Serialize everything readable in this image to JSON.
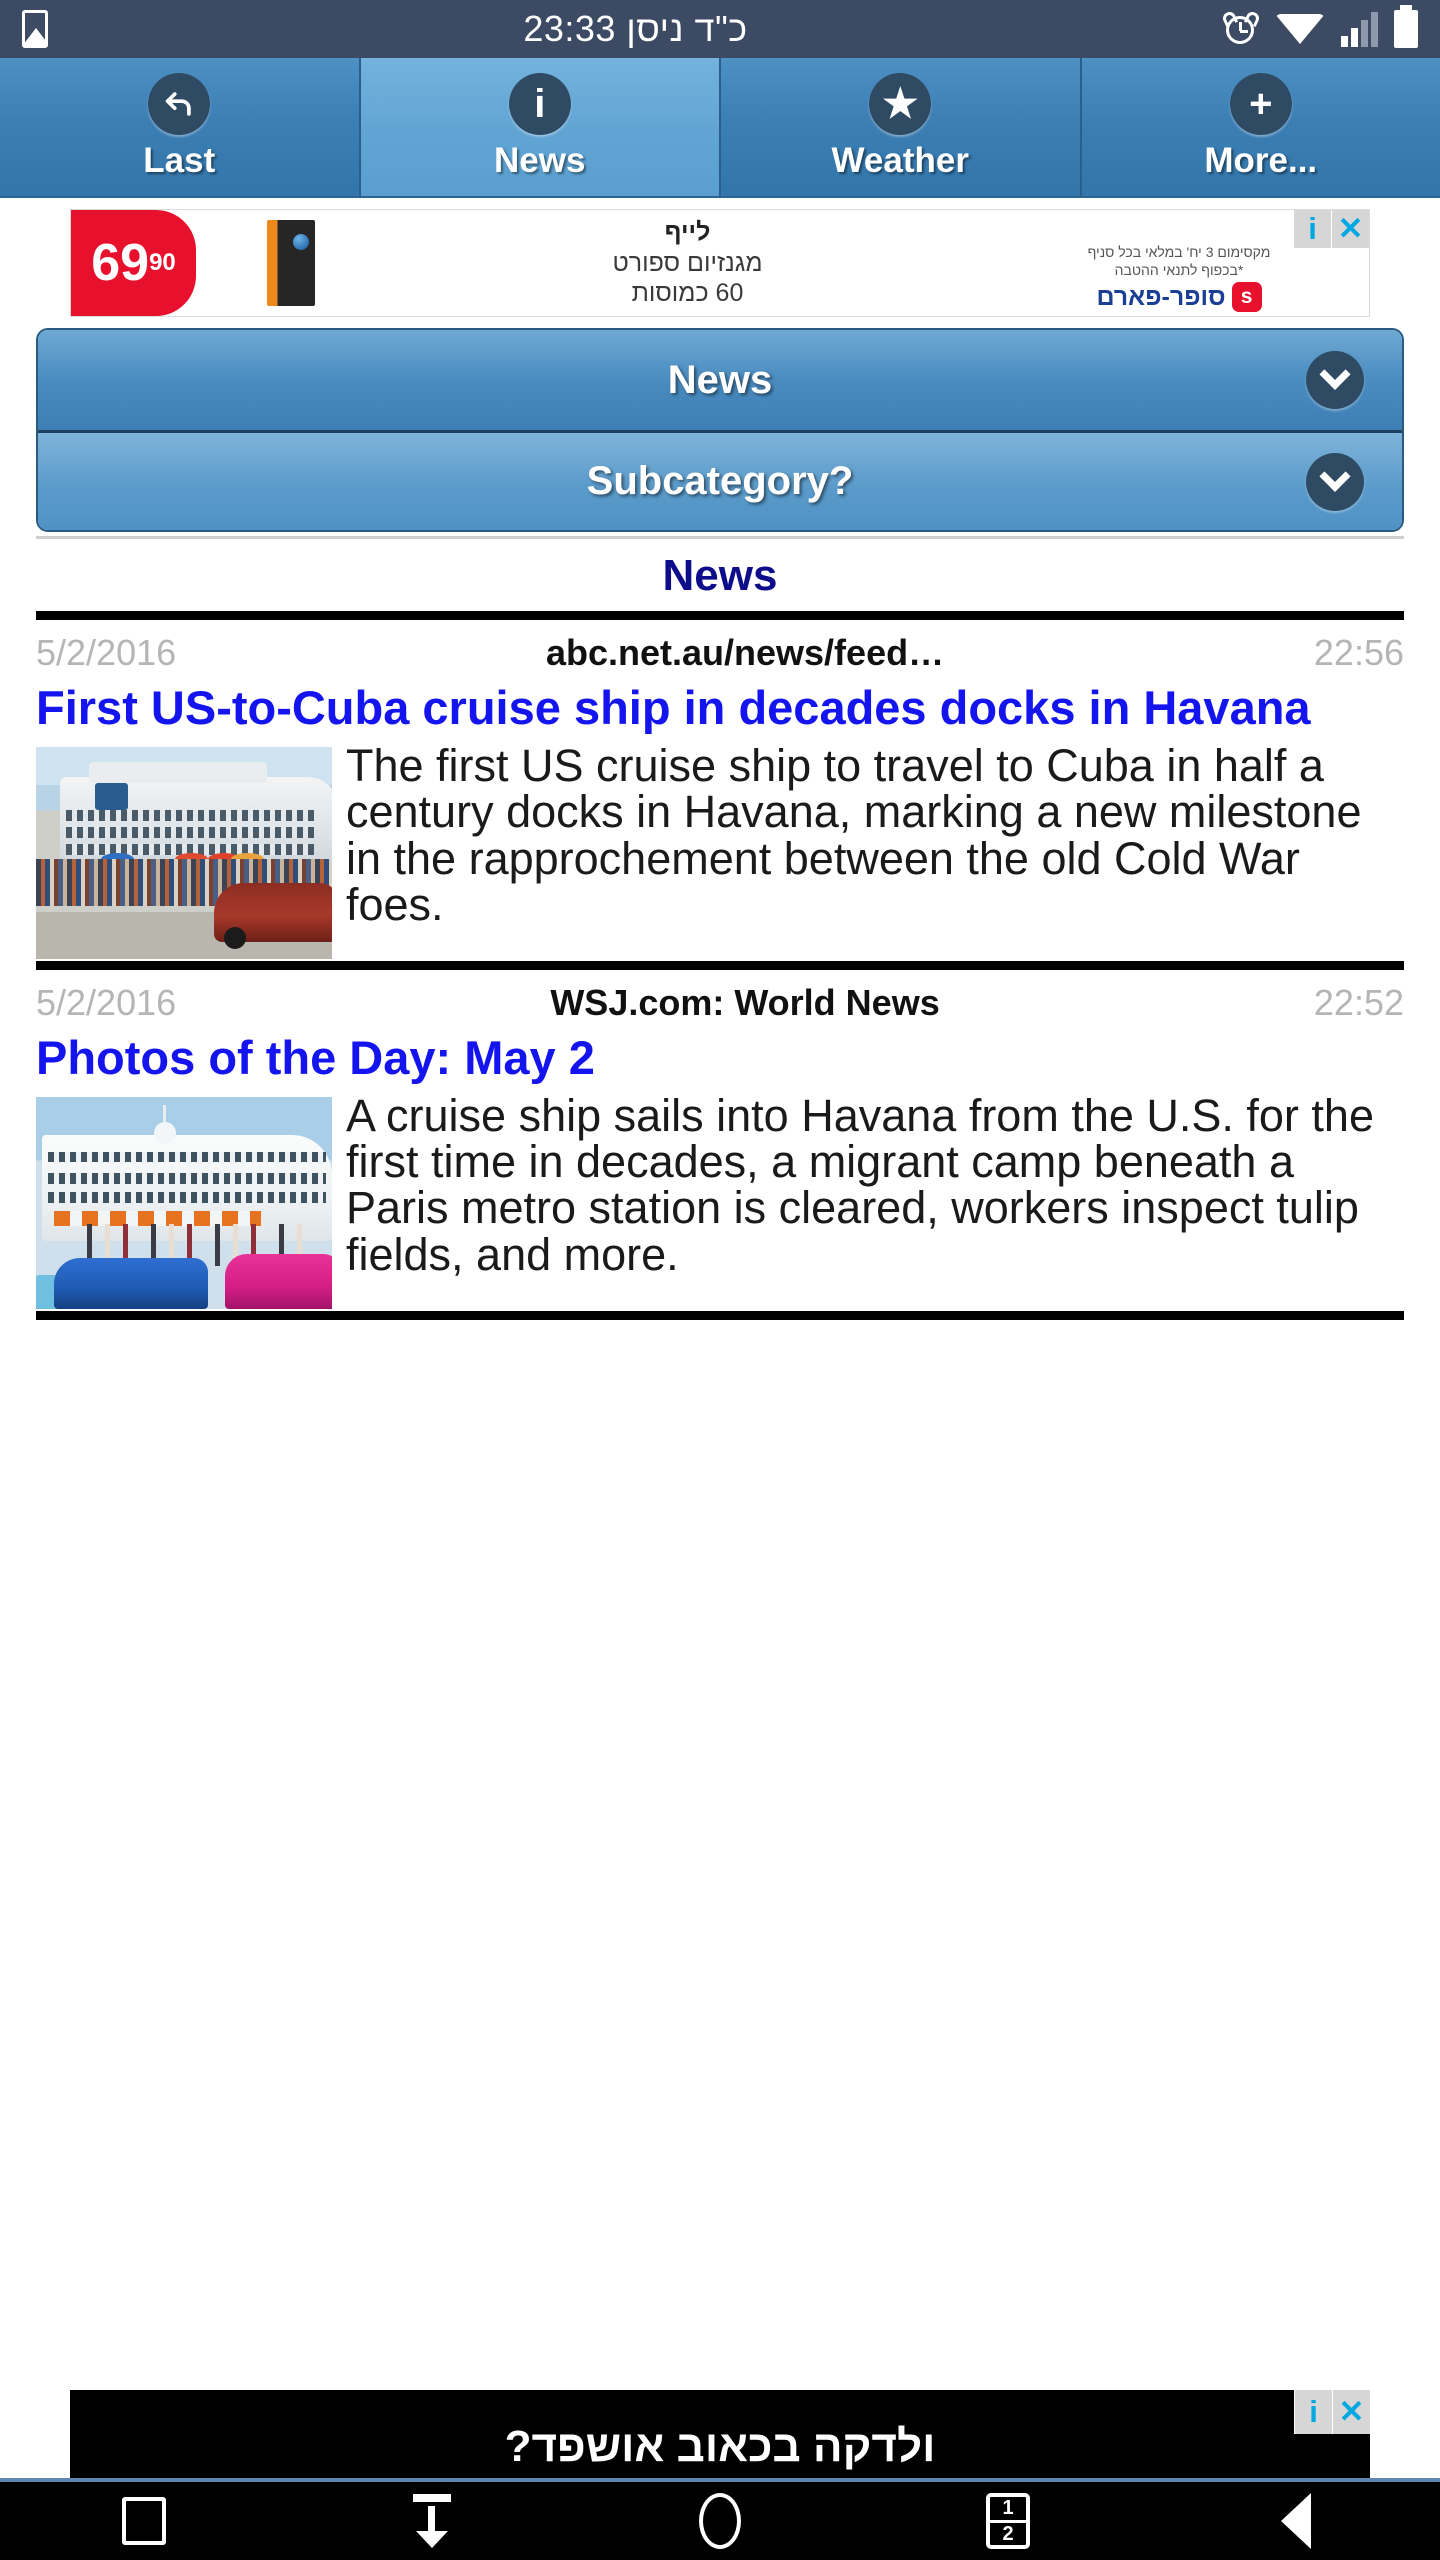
{
  "statusbar": {
    "time": "23:33",
    "date_hebrew": "כ\"ד ניסן",
    "center_text": "23:33 כ\"ד ניסן",
    "icons": [
      "gallery-icon",
      "alarm-icon",
      "wifi-icon",
      "signal-icon",
      "battery-icon"
    ]
  },
  "tabs": [
    {
      "label": "Last",
      "icon": "undo-arrow-icon",
      "glyph": "↶",
      "active": false
    },
    {
      "label": "News",
      "icon": "info-icon",
      "glyph": "i",
      "active": true
    },
    {
      "label": "Weather",
      "icon": "star-icon",
      "glyph": "★",
      "active": false
    },
    {
      "label": "More...",
      "icon": "plus-icon",
      "glyph": "+",
      "active": false
    }
  ],
  "top_ad": {
    "price_main": "69",
    "price_cents": "90",
    "line1": "לייף",
    "line2": "מגנזיום ספורט",
    "line3": "60 כמוסות",
    "fine_line1": "מקסימום 3 יח' במלאי בכל סניף",
    "fine_line2": "*בכפוף לתנאי ההטבה",
    "brand": "סופר-פארם",
    "brand_mark": "s",
    "info_label": "i",
    "close_label": "✕"
  },
  "selectors": [
    {
      "label": "News",
      "icon": "chevron-down-icon"
    },
    {
      "label": "Subcategory?",
      "icon": "chevron-down-icon"
    }
  ],
  "feed": {
    "section_title": "News",
    "articles": [
      {
        "date": "5/2/2016",
        "source": "abc.net.au/news/feed…",
        "time": "22:56",
        "headline": "First US-to-Cuba cruise ship in decades docks in Havana",
        "body": "The first US cruise ship to travel to Cuba in half a century docks in Havana, marking a new milestone in the rapprochement between the old Cold War foes.",
        "thumb_alt": "cruise-ship-crowd-red-vintage-car"
      },
      {
        "date": "5/2/2016",
        "source": "WSJ.com: World News",
        "time": "22:52",
        "headline": "Photos of the Day: May 2",
        "body": "A cruise ship sails into Havana from the U.S. for the first time in decades, a migrant camp beneath a Paris metro station is cleared, workers inspect tulip fields, and more.",
        "thumb_alt": "cruise-ship-blue-pink-vintage-cars"
      }
    ]
  },
  "bottom_ad": {
    "text": "ולדקה בכאוב אושפד?",
    "info_label": "i",
    "close_label": "✕"
  },
  "navbar": [
    {
      "name": "recents-button",
      "icon": "square-icon"
    },
    {
      "name": "download-button",
      "icon": "download-arrow-icon"
    },
    {
      "name": "home-button",
      "icon": "circle-icon"
    },
    {
      "name": "tab-switcher-button",
      "icon": "tabs-icon",
      "top": "1",
      "bottom": "2"
    },
    {
      "name": "back-button",
      "icon": "back-triangle-icon"
    }
  ],
  "colors": {
    "status_bar": "#3c4a63",
    "tab_bar": "#3c7fb4",
    "tab_active": "#62a5d4",
    "headline_blue": "#1414ee",
    "section_blue": "#0d0d8c",
    "ad_red": "#e8112d",
    "ad_cyan": "#00a7e1"
  }
}
